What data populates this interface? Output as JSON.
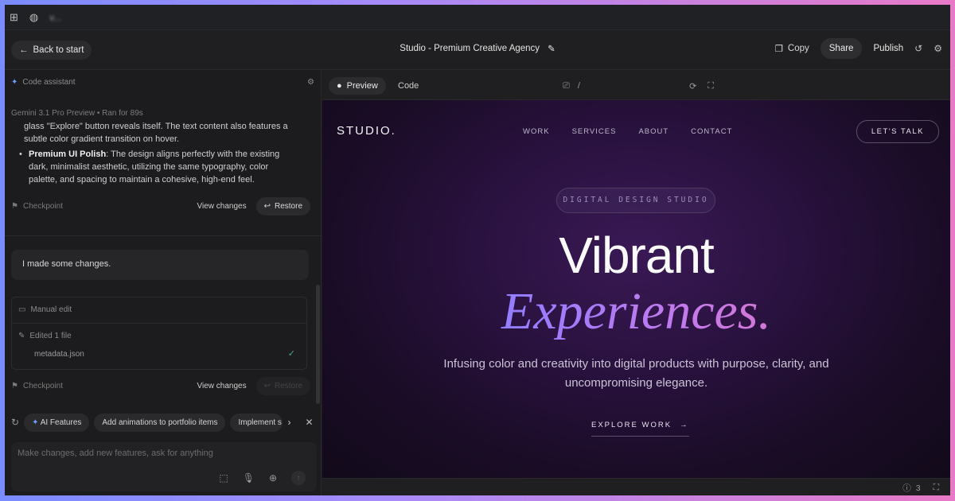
{
  "browser": {
    "grid_icon": "apps-grid-icon",
    "globe_icon": "globe-icon",
    "tab_title": "v..."
  },
  "topbar": {
    "back_label": "Back to start",
    "title": "Studio - Premium Creative Agency",
    "copy_label": "Copy",
    "share_label": "Share",
    "publish_label": "Publish"
  },
  "assistant": {
    "header": "Code assistant",
    "meta": "Gemini 3.1 Pro Preview  •  Ran for 89s",
    "para_text": "glass \"Explore\" button reveals itself. The text content also features a subtle color gradient transition on hover.",
    "bullet_bold": "Premium UI Polish",
    "bullet_text": ": The design aligns perfectly with the existing dark, minimalist aesthetic, utilizing the same typography, color palette, and spacing to maintain a cohesive, high-end feel.",
    "checkpoint_label": "Checkpoint",
    "view_changes": "View changes",
    "restore": "Restore",
    "user_message": "I made some changes.",
    "manual_edit": "Manual edit",
    "edited_files": "Edited 1 file",
    "file_name": "metadata.json",
    "checkpoint2_label": "Checkpoint",
    "view_changes2": "View changes",
    "restore2": "Restore"
  },
  "suggestions": [
    "AI Features",
    "Add animations to portfolio items",
    "Implement s"
  ],
  "input": {
    "placeholder": "Make changes, add new features, ask for anything"
  },
  "preview_tabs": {
    "preview": "Preview",
    "code": "Code",
    "path": "/"
  },
  "site": {
    "logo": "STUDIO.",
    "nav": [
      "WORK",
      "SERVICES",
      "ABOUT",
      "CONTACT"
    ],
    "cta": "LET'S TALK",
    "pill": "DIGITAL DESIGN STUDIO",
    "headline": "Vibrant",
    "headline2": "Experiences.",
    "subtitle": "Infusing color and creativity into digital products with purpose, clarity, and uncompromising elegance.",
    "explore": "EXPLORE WORK"
  },
  "footer": {
    "issues_count": "3"
  },
  "colors": {
    "accent_blue": "#6aa0ff",
    "success": "#3fb27f",
    "gradient_start": "#6a8dff",
    "gradient_end": "#ef6ea6"
  }
}
